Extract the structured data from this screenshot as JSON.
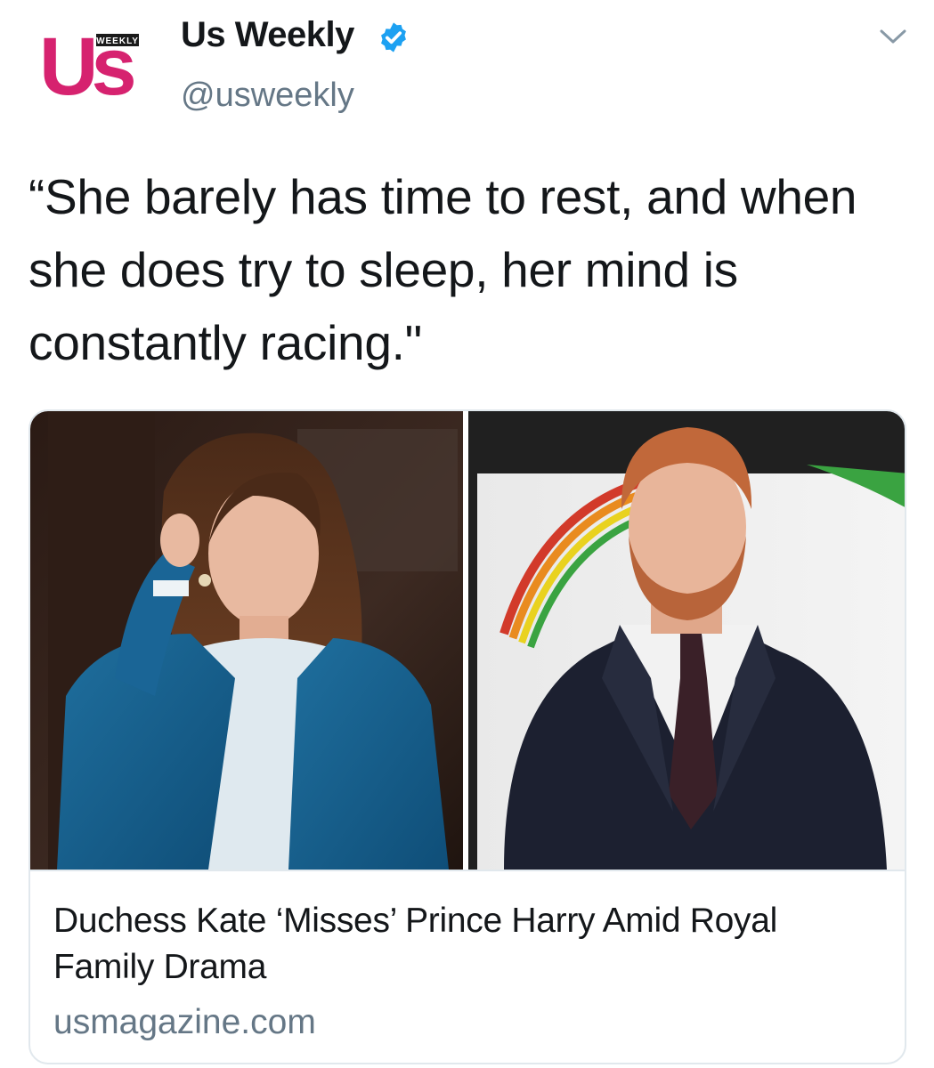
{
  "account": {
    "display_name": "Us Weekly",
    "handle": "@usweekly",
    "verified": true,
    "logo_text": "Us",
    "logo_badge": "WEEKLY",
    "logo_color": "#d6226f"
  },
  "tweet": {
    "text": "“She barely has time to rest, and when she does try to sleep, her mind is constantly racing.\""
  },
  "card": {
    "title": "Duchess Kate ‘Misses’ Prince Harry Amid Royal Family Drama",
    "domain": "usmagazine.com"
  },
  "icons": {
    "verified": "verified-badge-icon",
    "menu": "chevron-down-icon"
  },
  "colors": {
    "verified_blue": "#1da1f2",
    "secondary_text": "#657786",
    "border": "#e1e8ed"
  }
}
